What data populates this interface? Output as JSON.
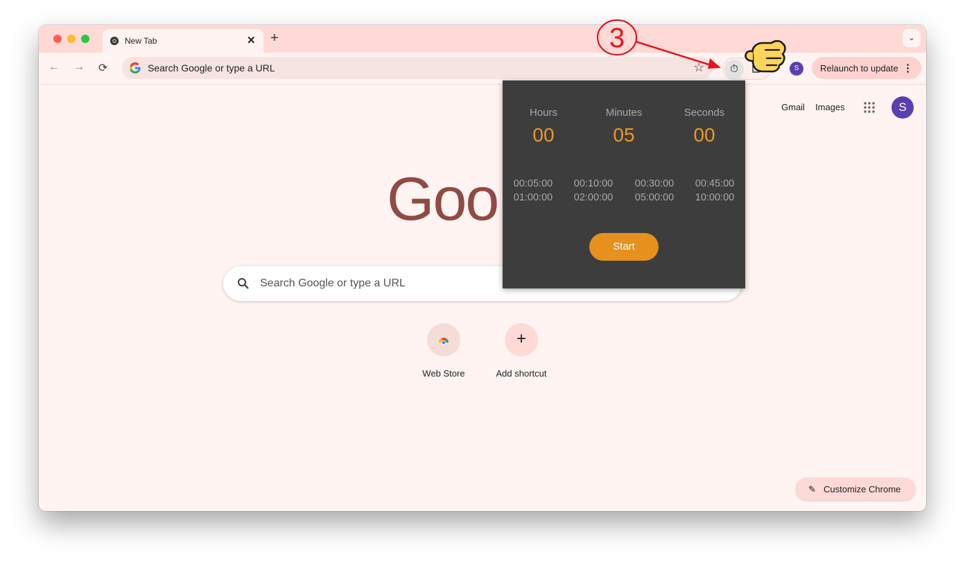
{
  "tab": {
    "title": "New Tab",
    "close": "✕",
    "new": "+",
    "search_menu": "⌄"
  },
  "omnibox": {
    "text": "Search Google or type a URL"
  },
  "toolbar": {
    "back": "←",
    "forward": "→",
    "reload": "⟳",
    "star": "☆",
    "timer_ext": "⏱",
    "profile_initial": "S",
    "relaunch_label": "Relaunch to update",
    "relaunch_menu": "⋮"
  },
  "ntp": {
    "gmail": "Gmail",
    "images": "Images",
    "avatar_initial": "S",
    "logo_partial": "Goo",
    "search_placeholder": "Search Google or type a URL",
    "shortcuts": [
      {
        "label": "Web Store",
        "icon": "chrome-web-store-icon"
      },
      {
        "label": "Add shortcut",
        "icon": "plus-icon",
        "glyph": "+"
      }
    ],
    "customize_label": "Customize Chrome",
    "customize_icon": "✎"
  },
  "timer_popup": {
    "units": [
      {
        "label": "Hours",
        "value": "00"
      },
      {
        "label": "Minutes",
        "value": "05"
      },
      {
        "label": "Seconds",
        "value": "00"
      }
    ],
    "presets_row1": [
      "00:05:00",
      "00:10:00",
      "00:30:00",
      "00:45:00"
    ],
    "presets_row2": [
      "01:00:00",
      "02:00:00",
      "05:00:00",
      "10:00:00"
    ],
    "start_label": "Start",
    "accent_color": "#e6901e"
  },
  "annotation": {
    "step_number": "3"
  }
}
